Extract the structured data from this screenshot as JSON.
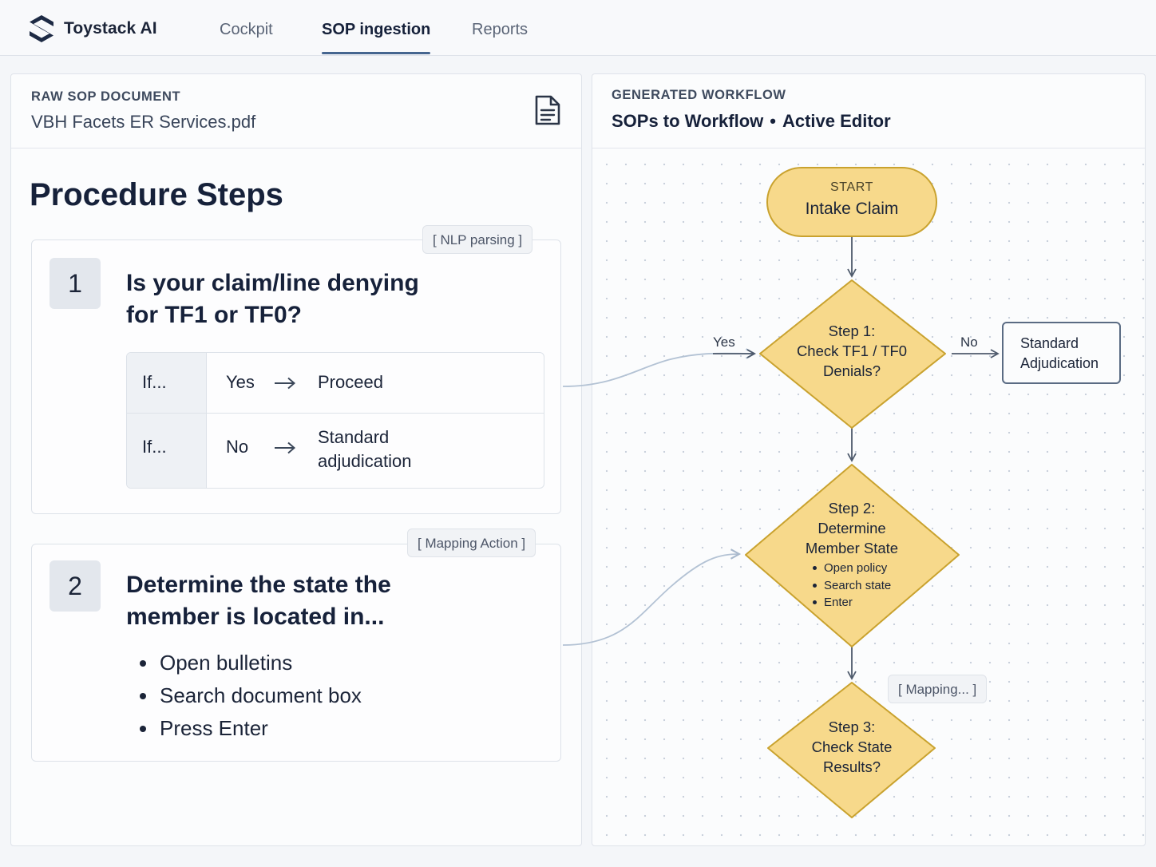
{
  "app": {
    "brand": "Toystack AI",
    "nav": [
      {
        "label": "Cockpit",
        "active": false
      },
      {
        "label": "SOP ingestion",
        "active": true
      },
      {
        "label": "Reports",
        "active": false
      }
    ],
    "accent_color": "#45658f"
  },
  "left_panel": {
    "eyebrow": "RAW SOP DOCUMENT",
    "file_name": "VBH Facets ER Services.pdf",
    "doc_icon": "document-icon",
    "heading": "Procedure Steps",
    "steps": [
      {
        "number": "1",
        "tag": "[ NLP parsing ]",
        "question_line1": "Is your claim/line denying",
        "question_line2": "for TF1 or TF0?",
        "rules": [
          {
            "if": "If...",
            "condition": "Yes",
            "arrow_icon": "arrow-right-icon",
            "result_line1": "Proceed",
            "result_line2": ""
          },
          {
            "if": "If...",
            "condition": "No",
            "arrow_icon": "arrow-right-icon",
            "result_line1": "Standard",
            "result_line2": "adjudication"
          }
        ]
      },
      {
        "number": "2",
        "tag": "[ Mapping Action ]",
        "question_line1": "Determine the state the",
        "question_line2": "member is located in...",
        "bullets": [
          "Open bulletins",
          "Search document box",
          "Press Enter"
        ]
      }
    ]
  },
  "right_panel": {
    "eyebrow": "GENERATED WORKFLOW",
    "title": "SOPs to Workflow",
    "separator": "•",
    "mode": "Active Editor",
    "flow": {
      "start": {
        "label": "START",
        "title": "Intake Claim"
      },
      "step1": {
        "lines": [
          "Step 1:",
          "Check TF1 / TF0",
          "Denials?"
        ]
      },
      "yes_label": "Yes",
      "no_label": "No",
      "standard": {
        "lines": [
          "Standard",
          "Adjudication"
        ]
      },
      "step2": {
        "lines": [
          "Step 2:",
          "Determine",
          "Member State"
        ],
        "items": [
          "Open policy",
          "Search state",
          "Enter"
        ]
      },
      "mapping_tag": "[ Mapping... ]",
      "step3": {
        "lines": [
          "Step 3:",
          "Check State",
          "Results?"
        ]
      }
    },
    "node_fill": "#f7d98b",
    "node_stroke": "#c9a22e"
  }
}
